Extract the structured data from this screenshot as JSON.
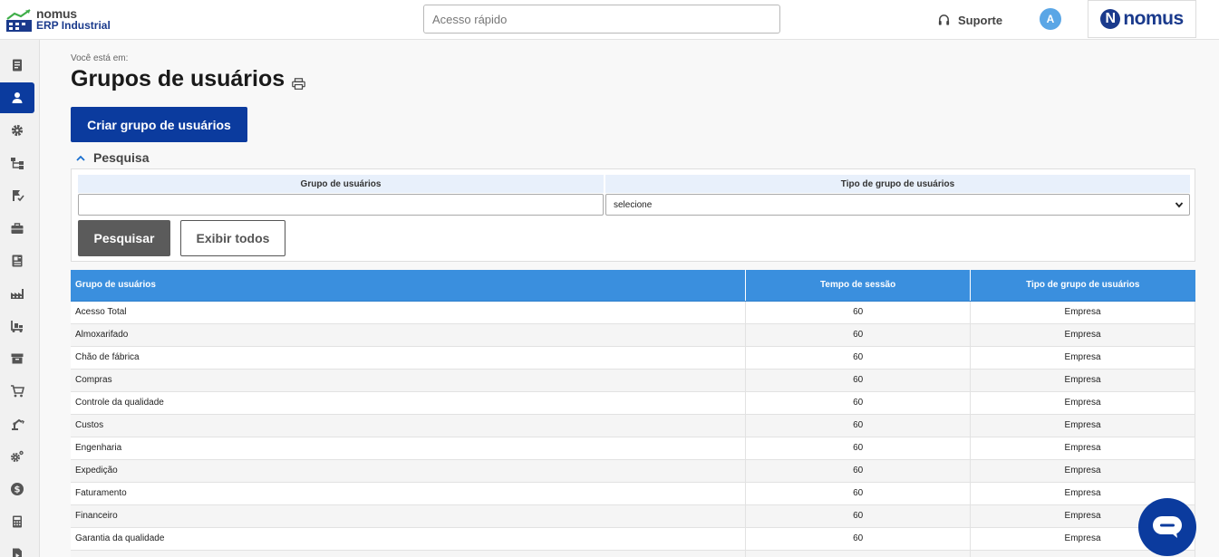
{
  "header": {
    "logo_line1": "nomus",
    "logo_line2": "ERP Industrial",
    "quick_search_placeholder": "Acesso rápido",
    "support_label": "Suporte",
    "avatar_initial": "A",
    "brand_initial": "N",
    "brand_word": "nomus"
  },
  "sidebar": {
    "items": [
      {
        "icon": "document-icon",
        "active": false
      },
      {
        "icon": "user-icon",
        "active": true
      },
      {
        "icon": "gear-icon",
        "active": false
      },
      {
        "icon": "flowchart-icon",
        "active": false
      },
      {
        "icon": "flag-check-icon",
        "active": false
      },
      {
        "icon": "briefcase-icon",
        "active": false
      },
      {
        "icon": "newspaper-icon",
        "active": false
      },
      {
        "icon": "factory-icon",
        "active": false
      },
      {
        "icon": "forklift-icon",
        "active": false
      },
      {
        "icon": "archive-icon",
        "active": false
      },
      {
        "icon": "cart-icon",
        "active": false
      },
      {
        "icon": "robot-arm-icon",
        "active": false
      },
      {
        "icon": "gears-icon",
        "active": false
      },
      {
        "icon": "dollar-icon",
        "active": false
      },
      {
        "icon": "calculator-icon",
        "active": false
      },
      {
        "icon": "play-file-icon",
        "active": false
      }
    ]
  },
  "page": {
    "breadcrumb_label": "Você está em:",
    "title": "Grupos de usuários",
    "create_button": "Criar grupo de usuários"
  },
  "search": {
    "toggle_label": "Pesquisa",
    "field1_label": "Grupo de usuários",
    "field1_value": "",
    "field2_label": "Tipo de grupo de usuários",
    "field2_selected": "selecione",
    "search_button": "Pesquisar",
    "show_all_button": "Exibir todos"
  },
  "table": {
    "headers": [
      "Grupo de usuários",
      "Tempo de sessão",
      "Tipo de grupo de usuários"
    ],
    "rows": [
      [
        "Acesso Total",
        "60",
        "Empresa"
      ],
      [
        "Almoxarifado",
        "60",
        "Empresa"
      ],
      [
        "Chão de fábrica",
        "60",
        "Empresa"
      ],
      [
        "Compras",
        "60",
        "Empresa"
      ],
      [
        "Controle da qualidade",
        "60",
        "Empresa"
      ],
      [
        "Custos",
        "60",
        "Empresa"
      ],
      [
        "Engenharia",
        "60",
        "Empresa"
      ],
      [
        "Expedição",
        "60",
        "Empresa"
      ],
      [
        "Faturamento",
        "60",
        "Empresa"
      ],
      [
        "Financeiro",
        "60",
        "Empresa"
      ],
      [
        "Garantia da qualidade",
        "60",
        "Empresa"
      ],
      [
        "",
        "",
        ""
      ]
    ]
  },
  "colors": {
    "primary": "#0b3b9e",
    "table_header": "#3a8fde",
    "search_button": "#5b5b5b"
  }
}
